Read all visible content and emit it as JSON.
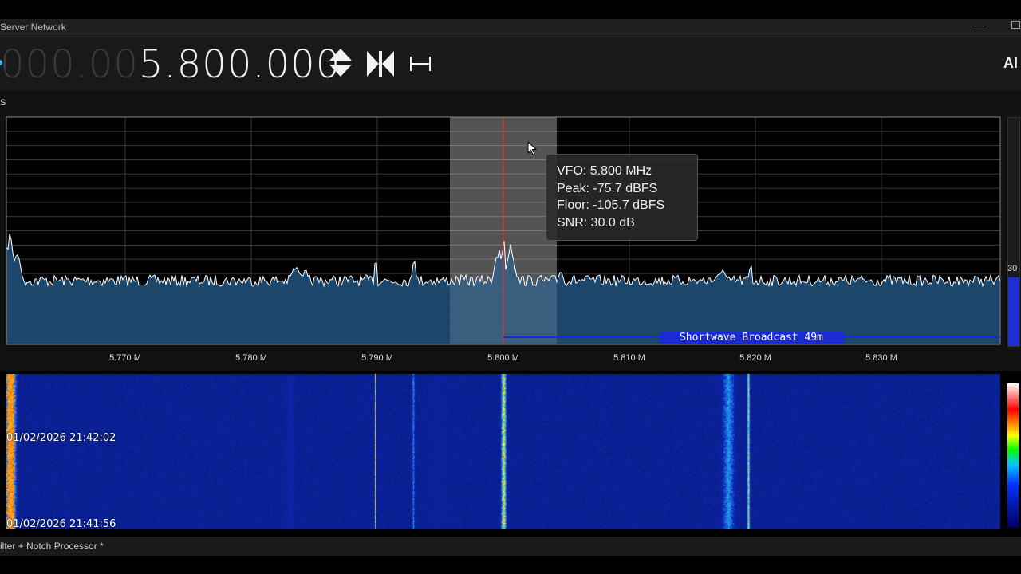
{
  "window": {
    "title": "Server Network"
  },
  "toolbar": {
    "freq_dim": "000.00",
    "freq_bright": "5.800.000",
    "icons": [
      "tuning-step-arrows-icon",
      "snap-to-center-icon",
      "bandwidth-icon"
    ],
    "logo": "AI"
  },
  "spectrum": {
    "scale_label": "S",
    "x_ticks": [
      "5.770 M",
      "5.780 M",
      "5.790 M",
      "5.800 M",
      "5.810 M",
      "5.820 M",
      "5.830 M"
    ],
    "band_label": "Shortwave Broadcast 49m",
    "level_value": "30",
    "colors": {
      "fill": "#1d4a70",
      "trace": "#ffffff",
      "vfo": "#ff2a2a",
      "band": "#1a2bd6"
    }
  },
  "tooltip": {
    "vfo": "VFO:  5.800 MHz",
    "peak": "Peak: -75.7 dBFS",
    "floor": "Floor: -105.7 dBFS",
    "snr": "SNR:  30.0 dB"
  },
  "waterfall": {
    "timestamp_top": "01/02/2026 21:42:02",
    "timestamp_bottom": "01/02/2026 21:41:56"
  },
  "status": {
    "text": "ilter + Notch Processor *"
  }
}
